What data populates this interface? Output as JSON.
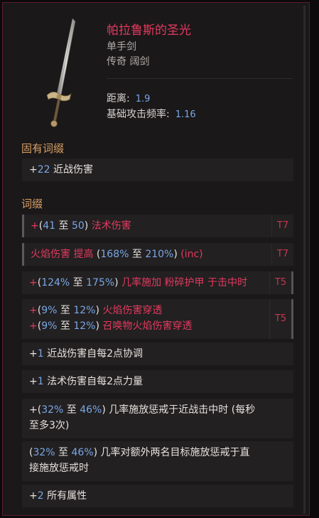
{
  "item": {
    "name": "帕拉鲁斯的圣光",
    "type_line": "单手剑",
    "rarity_line": "传奇 阔剑"
  },
  "stats": {
    "range_label": "距离:",
    "range_value": "1.9",
    "speed_label": "基础攻击频率:",
    "speed_value": "1.16"
  },
  "implicit": {
    "title": "固有词缀",
    "rows": [
      {
        "plus": "+",
        "num": "22",
        "text": " 近战伤害"
      }
    ]
  },
  "affixes": {
    "title": "词缀",
    "r1": {
      "plus": "+",
      "p1": "(",
      "n1": "41",
      "mid": " 至 ",
      "n2": "50",
      "p2": ") ",
      "text": "法术伤害",
      "tier": "T7"
    },
    "r2": {
      "text": "火焰伤害 提高 ",
      "p1": "(",
      "n1": "168%",
      "mid": " 至 ",
      "n2": "210%",
      "p2": ")",
      "tag": " (inc)",
      "tier": "T7"
    },
    "r3": {
      "plus": "+",
      "p1": "(",
      "n1": "124%",
      "mid": " 至 ",
      "n2": "175%",
      "p2": ") ",
      "text": "几率施加 粉碎护甲 于击中时",
      "tier": "T5"
    },
    "r4": {
      "a": {
        "plus": "+",
        "p1": "(",
        "n1": "9%",
        "mid": " 至 ",
        "n2": "12%",
        "p2": ") ",
        "text": "火焰伤害穿透"
      },
      "b": {
        "plus": "+",
        "p1": "(",
        "n1": "9%",
        "mid": " 至 ",
        "n2": "12%",
        "p2": ") ",
        "text": "召唤物火焰伤害穿透"
      },
      "tier": "T5"
    },
    "r5": {
      "plus": "+",
      "num": "1",
      "text": " 近战伤害自每2点协调"
    },
    "r6": {
      "plus": "+",
      "num": "1",
      "text": " 法术伤害自每2点力量"
    },
    "r7": {
      "plus": "+",
      "p1": "(",
      "n1": "32%",
      "mid": " 至 ",
      "n2": "46%",
      "p2": ")",
      "text1": " 几率施放惩戒于近战击中时 (每秒",
      "text2": "至多3次)"
    },
    "r8": {
      "p1": "(",
      "n1": "32%",
      "mid": " 至 ",
      "n2": "46%",
      "p2": ")",
      "text1": " 几率对额外两名目标施放惩戒于直",
      "text2": "接施放惩戒时"
    },
    "r9": {
      "plus": "+",
      "num": "2",
      "text": " 所有属性"
    }
  },
  "colors": {
    "name": "#e33a5f",
    "number": "#7aa7e6",
    "section": "#d9a066",
    "tier": "#c6374f"
  },
  "icons": {
    "item_image": "broadsword-icon"
  }
}
